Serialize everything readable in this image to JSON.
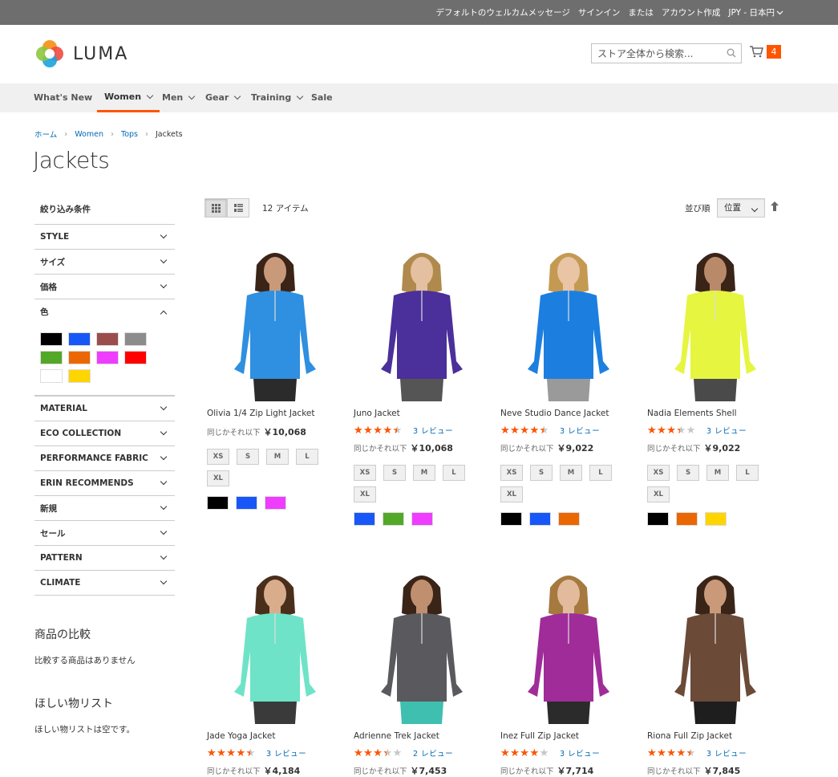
{
  "topbar": {
    "welcome": "デフォルトのウェルカムメッセージ",
    "sign_in": "サインイン",
    "or": "または",
    "create_account": "アカウント作成",
    "currency": "JPY - 日本円"
  },
  "header": {
    "logo_text": "LUMA",
    "search_placeholder": "ストア全体から検索...",
    "cart_count": "4"
  },
  "nav": {
    "items": [
      {
        "label": "What's New"
      },
      {
        "label": "Women"
      },
      {
        "label": "Men"
      },
      {
        "label": "Gear"
      },
      {
        "label": "Training"
      },
      {
        "label": "Sale"
      }
    ],
    "active": "Women"
  },
  "breadcrumb": [
    "ホーム",
    "Women",
    "Tops",
    "Jackets"
  ],
  "page_title": "Jackets",
  "sidebar": {
    "title": "絞り込み条件",
    "filters_top": [
      "STYLE",
      "サイズ",
      "価格",
      "色"
    ],
    "color_swatches": [
      "#000000",
      "#1857f7",
      "#9b4d4d",
      "#8c8c8c",
      "#53a828",
      "#eb6703",
      "#ef3dff",
      "#ff0000",
      "#ffffff",
      "#ffd500"
    ],
    "filters_bottom": [
      "MATERIAL",
      "ECO COLLECTION",
      "PERFORMANCE FABRIC",
      "ERIN RECOMMENDS",
      "新規",
      "セール",
      "PATTERN",
      "CLIMATE"
    ],
    "compare_title": "商品の比較",
    "compare_text": "比較する商品はありません",
    "wishlist_title": "ほしい物リスト",
    "wishlist_text": "ほしい物リストは空です。"
  },
  "toolbar": {
    "item_count": "12 アイテム",
    "sort_label": "並び順",
    "sort_value": "位置"
  },
  "products": [
    {
      "name": "Olivia 1/4 Zip Light Jacket",
      "rating": 0,
      "reviews": "",
      "price_label": "同じかそれ以下",
      "price": "￥10,068",
      "sizes": [
        "XS",
        "S",
        "M",
        "L",
        "XL"
      ],
      "colors": [
        "#000000",
        "#1857f7",
        "#ef3dff"
      ],
      "jacket_color": "#2f8fe0",
      "pants_color": "#2b2b2b",
      "skin": "#c99a7a",
      "hair": "#3a2418"
    },
    {
      "name": "Juno Jacket",
      "rating": 0.8,
      "reviews": "3 レビュー",
      "price_label": "同じかそれ以下",
      "price": "￥10,068",
      "sizes": [
        "XS",
        "S",
        "M",
        "L",
        "XL"
      ],
      "colors": [
        "#1857f7",
        "#53a828",
        "#ef3dff"
      ],
      "jacket_color": "#4b2f9a",
      "pants_color": "#555555",
      "skin": "#e4bfa0",
      "hair": "#b08a4c"
    },
    {
      "name": "Neve Studio Dance Jacket",
      "rating": 0.8,
      "reviews": "3 レビュー",
      "price_label": "同じかそれ以下",
      "price": "￥9,022",
      "sizes": [
        "XS",
        "S",
        "M",
        "L",
        "XL"
      ],
      "colors": [
        "#000000",
        "#1857f7",
        "#eb6703"
      ],
      "jacket_color": "#1c7fe0",
      "pants_color": "#9a9a9a",
      "skin": "#e9c4a5",
      "hair": "#c49a52"
    },
    {
      "name": "Nadia Elements Shell",
      "rating": 0.6,
      "reviews": "3 レビュー",
      "price_label": "同じかそれ以下",
      "price": "￥9,022",
      "sizes": [
        "XS",
        "S",
        "M",
        "L",
        "XL"
      ],
      "colors": [
        "#000000",
        "#eb6703",
        "#ffd500"
      ],
      "jacket_color": "#e6f540",
      "pants_color": "#4a4a4a",
      "skin": "#b98a6a",
      "hair": "#3a2418"
    },
    {
      "name": "Jade Yoga Jacket",
      "rating": 0.8,
      "reviews": "3 レビュー",
      "price_label": "同じかそれ以下",
      "price": "￥4,184",
      "sizes": [],
      "colors": [],
      "jacket_color": "#6ee3c8",
      "pants_color": "#3a3a3a",
      "skin": "#d9ad8c",
      "hair": "#4a2e1c"
    },
    {
      "name": "Adrienne Trek Jacket",
      "rating": 0.6,
      "reviews": "2 レビュー",
      "price_label": "同じかそれ以下",
      "price": "￥7,453",
      "sizes": [],
      "colors": [],
      "jacket_color": "#5a5a5e",
      "pants_color": "#3fbfb0",
      "skin": "#c08f70",
      "hair": "#3a2418"
    },
    {
      "name": "Inez Full Zip Jacket",
      "rating": 0.7,
      "reviews": "3 レビュー",
      "price_label": "同じかそれ以下",
      "price": "￥7,714",
      "sizes": [],
      "colors": [],
      "jacket_color": "#a02c9a",
      "pants_color": "#2b2b2b",
      "skin": "#e2bb9c",
      "hair": "#a6793f"
    },
    {
      "name": "Riona Full Zip Jacket",
      "rating": 0.8,
      "reviews": "3 レビュー",
      "price_label": "同じかそれ以下",
      "price": "￥7,845",
      "sizes": [],
      "colors": [],
      "jacket_color": "#6b4a38",
      "pants_color": "#1e1e1e",
      "skin": "#c9997a",
      "hair": "#3a2418"
    }
  ]
}
